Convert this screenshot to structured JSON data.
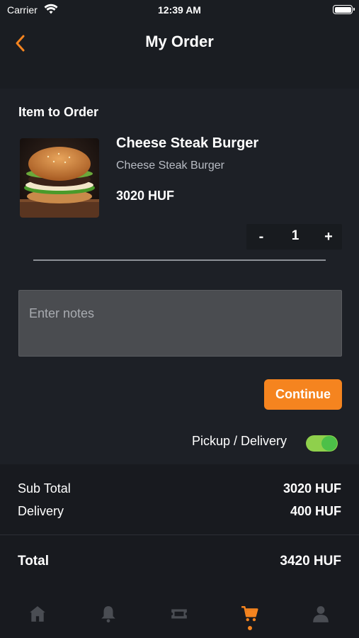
{
  "status_bar": {
    "carrier": "Carrier",
    "time": "12:39 AM"
  },
  "nav": {
    "title": "My Order",
    "back_icon": "chevron-left-icon"
  },
  "section": {
    "title": "Item to Order"
  },
  "item": {
    "name": "Cheese Steak Burger",
    "description": "Cheese Steak Burger",
    "price": "3020 HUF",
    "quantity": "1",
    "minus_label": "-",
    "plus_label": "+"
  },
  "notes": {
    "placeholder": "Enter notes",
    "value": ""
  },
  "continue_label": "Continue",
  "delivery_toggle": {
    "label": "Pickup / Delivery",
    "on": true
  },
  "summary": {
    "subtotal_label": "Sub Total",
    "subtotal_value": "3020 HUF",
    "delivery_label": "Delivery",
    "delivery_value": "400 HUF",
    "total_label": "Total",
    "total_value": "3420 HUF"
  },
  "tabs": [
    {
      "icon": "home-icon",
      "active": false
    },
    {
      "icon": "bell-icon",
      "active": false
    },
    {
      "icon": "ticket-icon",
      "active": false
    },
    {
      "icon": "cart-icon",
      "active": true
    },
    {
      "icon": "user-icon",
      "active": false
    }
  ],
  "colors": {
    "accent": "#f5841f",
    "background": "#1d2026",
    "toggle_on": "#8fd04c",
    "tab_inactive": "#4a4d53"
  }
}
